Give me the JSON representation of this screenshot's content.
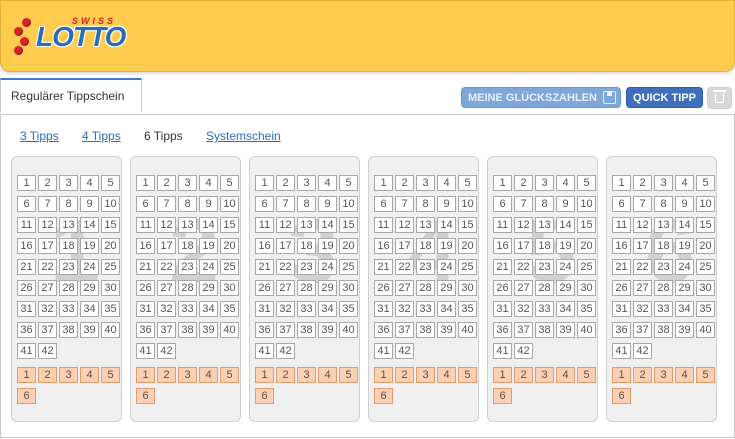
{
  "logo": {
    "swiss": "SWISS",
    "lotto": "LOTTO"
  },
  "tabs": {
    "active": "Regulärer Tippschein"
  },
  "actions": {
    "glueck_label": "MEINE GLÜCKSZAHLEN",
    "quick_label": "QUICK TIPP"
  },
  "subtabs": {
    "tipps3": "3 Tipps",
    "tipps4": "4 Tipps",
    "tipps6": "6 Tipps",
    "system": "Systemschein"
  },
  "grid_numbers": [
    "1",
    "2",
    "3",
    "4",
    "5",
    "6",
    "7",
    "8",
    "9",
    "10",
    "11",
    "12",
    "13",
    "14",
    "15",
    "16",
    "17",
    "18",
    "19",
    "20",
    "21",
    "22",
    "23",
    "24",
    "25",
    "26",
    "27",
    "28",
    "29",
    "30",
    "31",
    "32",
    "33",
    "34",
    "35",
    "36",
    "37",
    "38",
    "39",
    "40",
    "41",
    "42"
  ],
  "lucky_numbers": [
    "1",
    "2",
    "3",
    "4",
    "5",
    "6"
  ],
  "tickets": [
    {
      "index": "1"
    },
    {
      "index": "2"
    },
    {
      "index": "3"
    },
    {
      "index": "4"
    },
    {
      "index": "5"
    },
    {
      "index": "6"
    }
  ],
  "colors": {
    "header": "#ffcc4d",
    "accent_blue": "#3d6fbd",
    "lucky_orange": "#fbd1b5"
  },
  "icons": {
    "save": "save-icon",
    "trash": "trash-icon"
  }
}
